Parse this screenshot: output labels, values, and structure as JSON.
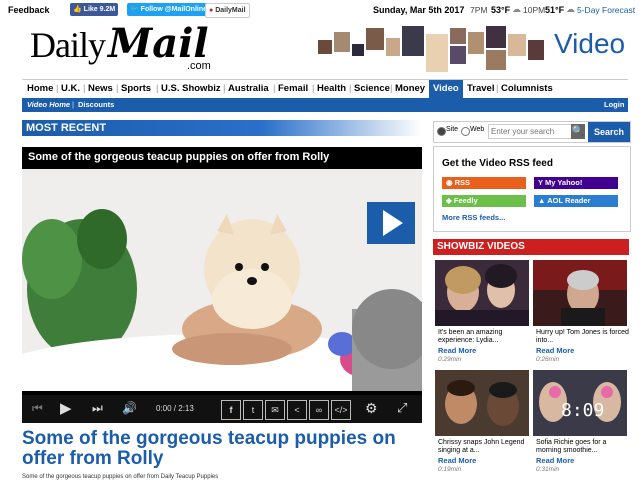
{
  "topbar": {
    "feedback": "Feedback",
    "fb_like": "Like 9.2M",
    "tw_follow": "Follow @MailOnline",
    "pinterest": "DailyMail",
    "date": "Sunday, Mar 5th 2017",
    "t1_time": "7PM",
    "t1_temp": "53°F",
    "t2_time": "10PM",
    "t2_temp": "51°F",
    "forecast": "5-Day Forecast"
  },
  "logo": {
    "daily": "Daily",
    "mail": "Mail",
    "com": ".com"
  },
  "section_title": "Video",
  "nav": {
    "items": [
      "Home",
      "U.K.",
      "News",
      "Sports",
      "U.S. Showbiz",
      "Australia",
      "Femail",
      "Health",
      "Science",
      "Money",
      "Video",
      "Travel",
      "Columnists"
    ],
    "active": "Video"
  },
  "subnav": {
    "left": [
      "Video Home",
      "Discounts"
    ],
    "login": "Login"
  },
  "most_recent": "MOST RECENT",
  "player": {
    "title": "Some of the gorgeous teacup puppies on offer from Rolly",
    "time": "0:00 / 2:13"
  },
  "headline": "Some of the gorgeous teacup puppies on offer from Rolly",
  "description": "Some of the gorgeous teacup puppies on offer from Daily Teacup Puppies",
  "search": {
    "opt_site": "Site",
    "opt_web": "Web",
    "placeholder": "Enter your search",
    "button": "Search"
  },
  "rss_box": {
    "heading": "Get the Video RSS feed",
    "buttons": [
      "RSS",
      "My Yahoo!",
      "Feedly",
      "AOL Reader"
    ],
    "more": "More RSS feeds..."
  },
  "showbiz": {
    "heading": "SHOWBIZ VIDEOS",
    "items": [
      {
        "caption": "It's been an amazing experience: Lydia...",
        "read": "Read More",
        "duration": "0:29min"
      },
      {
        "caption": "Hurry up! Tom Jones is forced into...",
        "read": "Read More",
        "duration": "0:26min"
      },
      {
        "caption": "Chrissy snaps John Legend singing at a...",
        "read": "Read More",
        "duration": "0:19min"
      },
      {
        "caption": "Sofia Richie goes for a morning smoothie...",
        "read": "Read More",
        "duration": "0:31min"
      }
    ]
  },
  "colors": {
    "brand_blue": "#1b5cab",
    "showbiz_red": "#cc1f1f"
  }
}
